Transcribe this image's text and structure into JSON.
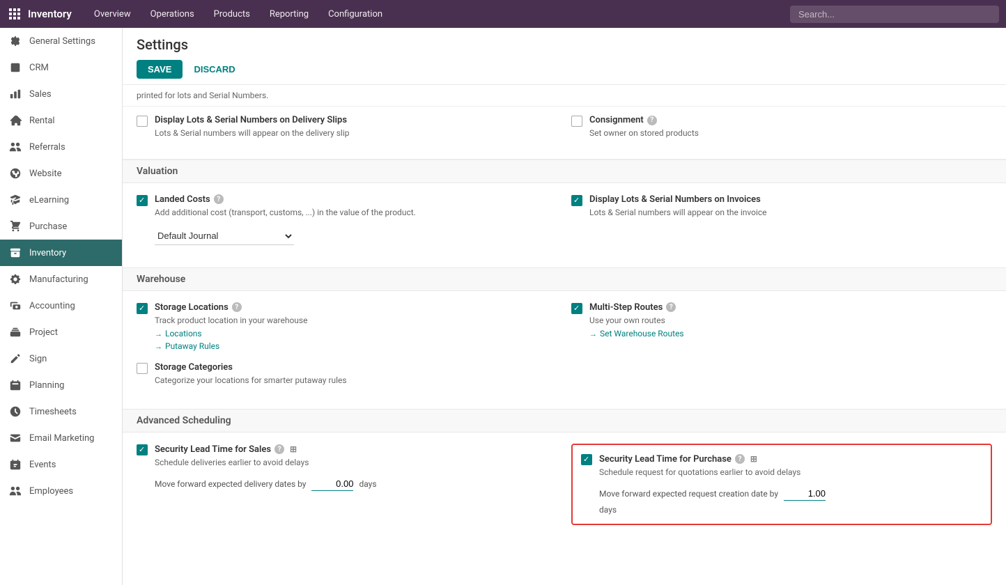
{
  "topnav": {
    "appname": "Inventory",
    "items": [
      "Overview",
      "Operations",
      "Products",
      "Reporting",
      "Configuration"
    ],
    "search_placeholder": "Search..."
  },
  "sidebar": {
    "items": [
      {
        "label": "General Settings",
        "icon": "gear"
      },
      {
        "label": "CRM",
        "icon": "crm"
      },
      {
        "label": "Sales",
        "icon": "sales"
      },
      {
        "label": "Rental",
        "icon": "rental"
      },
      {
        "label": "Referrals",
        "icon": "referrals"
      },
      {
        "label": "Website",
        "icon": "website"
      },
      {
        "label": "eLearning",
        "icon": "elearning"
      },
      {
        "label": "Purchase",
        "icon": "purchase"
      },
      {
        "label": "Inventory",
        "icon": "inventory"
      },
      {
        "label": "Manufacturing",
        "icon": "manufacturing"
      },
      {
        "label": "Accounting",
        "icon": "accounting"
      },
      {
        "label": "Project",
        "icon": "project"
      },
      {
        "label": "Sign",
        "icon": "sign"
      },
      {
        "label": "Planning",
        "icon": "planning"
      },
      {
        "label": "Timesheets",
        "icon": "timesheets"
      },
      {
        "label": "Email Marketing",
        "icon": "email"
      },
      {
        "label": "Events",
        "icon": "events"
      },
      {
        "label": "Employees",
        "icon": "employees"
      }
    ]
  },
  "page": {
    "title": "Settings",
    "save_label": "SAVE",
    "discard_label": "DISCARD"
  },
  "sections": {
    "top_truncated": "printed for lots and Serial Numbers.",
    "traceability_items": [
      {
        "id": "display_lots_delivery",
        "checked": false,
        "title": "Display Lots & Serial Numbers on Delivery Slips",
        "desc": "Lots & Serial numbers will appear on the delivery slip"
      },
      {
        "id": "consignment",
        "checked": false,
        "title": "Consignment",
        "desc": "Set owner on stored products"
      }
    ],
    "valuation": {
      "label": "Valuation",
      "items": [
        {
          "id": "landed_costs",
          "checked": true,
          "title": "Landed Costs",
          "has_help": true,
          "desc": "Add additional cost (transport, customs, ...) in the value of the product.",
          "dropdown_label": "Default Journal",
          "dropdown_options": [
            "Default Journal"
          ]
        },
        {
          "id": "display_lots_invoices",
          "checked": true,
          "title": "Display Lots & Serial Numbers on Invoices",
          "has_help": false,
          "desc": "Lots & Serial numbers will appear on the invoice"
        }
      ]
    },
    "warehouse": {
      "label": "Warehouse",
      "items": [
        {
          "id": "storage_locations",
          "checked": true,
          "title": "Storage Locations",
          "has_help": true,
          "desc": "Track product location in your warehouse",
          "links": [
            "Locations",
            "Putaway Rules"
          ]
        },
        {
          "id": "multi_step_routes",
          "checked": true,
          "title": "Multi-Step Routes",
          "has_help": true,
          "desc": "Use your own routes",
          "links": [
            "Set Warehouse Routes"
          ]
        }
      ],
      "bottom_items": [
        {
          "id": "storage_categories",
          "checked": false,
          "title": "Storage Categories",
          "has_help": false,
          "desc": "Categorize your locations for smarter putaway rules"
        }
      ]
    },
    "advanced_scheduling": {
      "label": "Advanced Scheduling",
      "items": [
        {
          "id": "security_lead_sales",
          "checked": true,
          "title": "Security Lead Time for Sales",
          "has_help": true,
          "has_sheet": true,
          "desc": "Schedule deliveries earlier to avoid delays",
          "move_label": "Move forward expected delivery dates by",
          "value": "0.00",
          "unit": "days"
        },
        {
          "id": "security_lead_purchase",
          "checked": true,
          "title": "Security Lead Time for Purchase",
          "has_help": true,
          "has_sheet": true,
          "desc": "Schedule request for quotations earlier to avoid delays",
          "move_label": "Move forward expected request creation date by",
          "value": "1.00",
          "unit": "days",
          "highlighted": true
        }
      ]
    }
  }
}
